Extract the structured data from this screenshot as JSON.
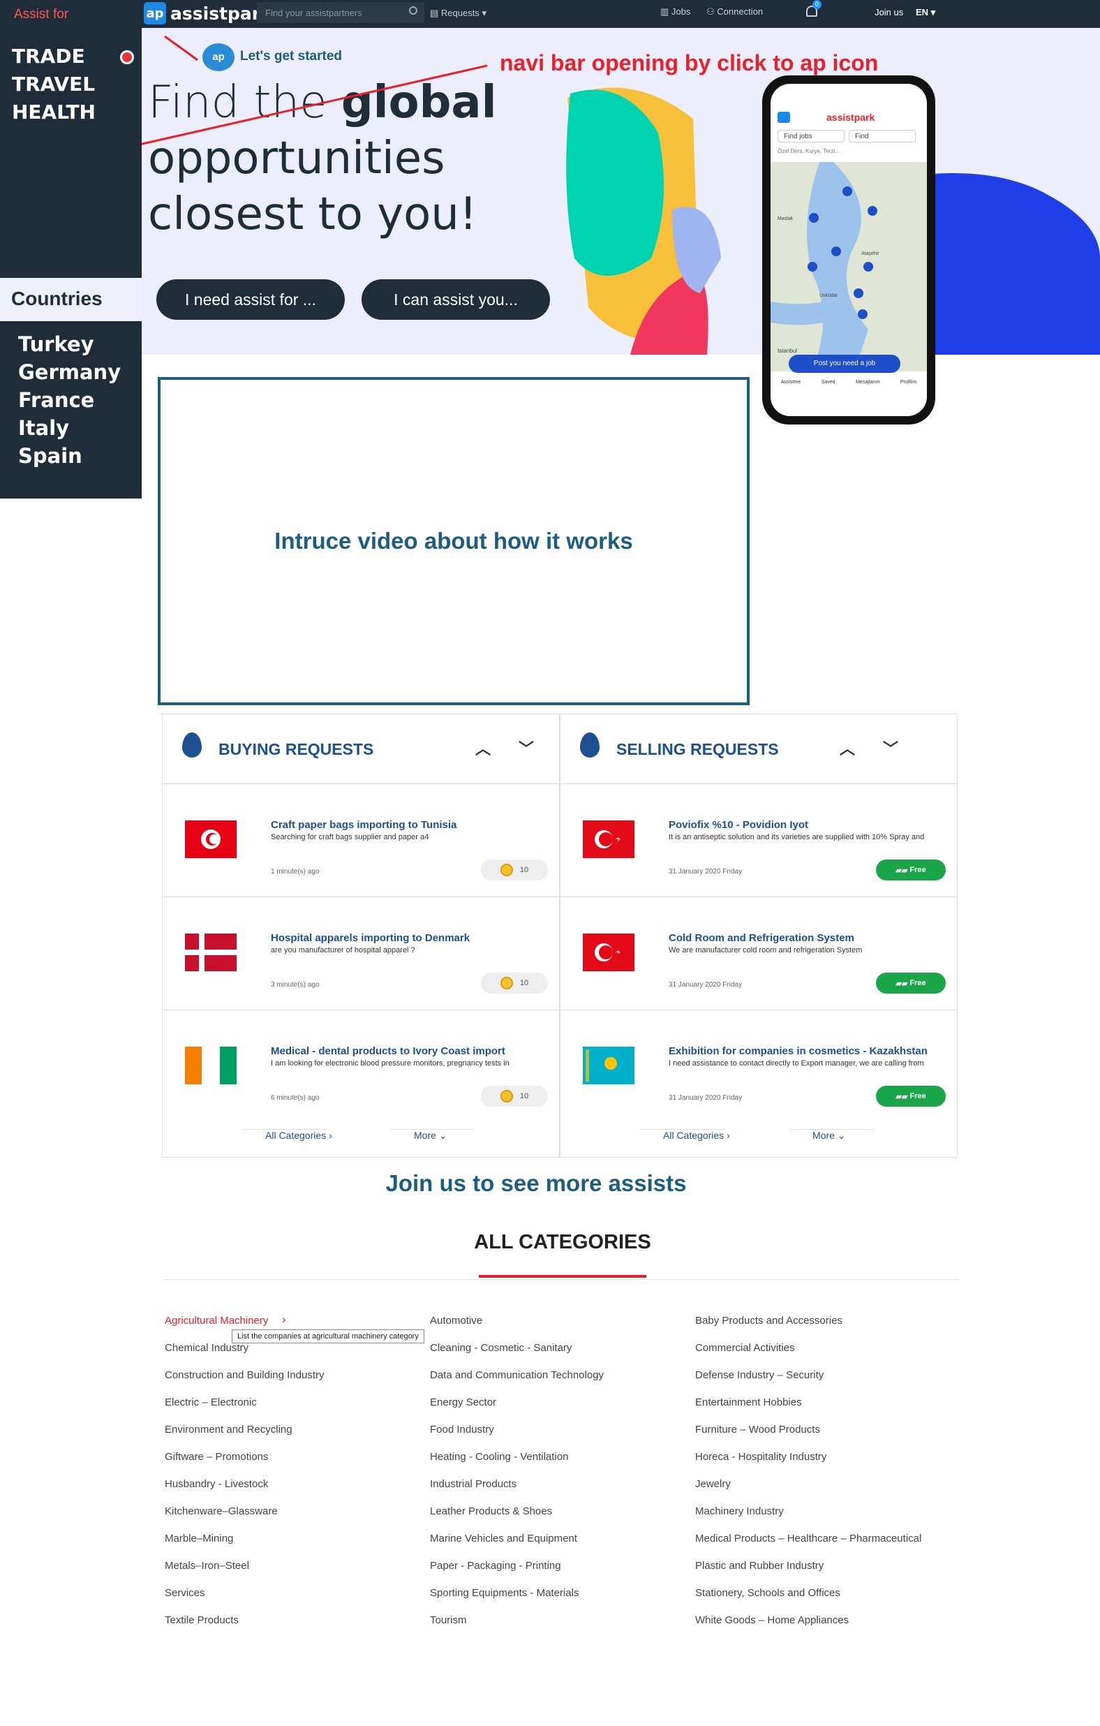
{
  "topbar": {
    "logo_text": "assistpark",
    "logo_mark": "ap",
    "search_placeholder": "Find your assistpartners",
    "requests_label": "Requests",
    "jobs_label": "Jobs",
    "connection_label": "Connection",
    "notif_count": "0",
    "join_label": "Join us",
    "lang_label": "EN"
  },
  "sidebar": {
    "assist_for": "Assist for",
    "categories": [
      "TRADE",
      "TRAVEL",
      "HEALTH"
    ],
    "countries_title": "Countries",
    "countries": [
      "Turkey",
      "Germany",
      "France",
      "Italy",
      "Spain"
    ]
  },
  "hero": {
    "started": "Let's get started",
    "ap_mark": "ap",
    "line1a": "Find the ",
    "line1b": "global",
    "line2": "opportunities",
    "line3": "closest to you!",
    "btn_need": "I need assist for ...",
    "btn_can": "I can assist you...",
    "annotation": "navi bar opening by click to ap icon"
  },
  "phone": {
    "brand": "assistpark",
    "tab_find_jobs": "Find jobs",
    "tab_find": "Find",
    "search_placeholder": "Özel Ders, Kurye, Terzi...",
    "cta": "Post you need a job",
    "nav": [
      "Assistme",
      "Saved",
      "Mesajlarım",
      "Profilim"
    ],
    "map_labels": [
      "Maslak",
      "Ataşehir",
      "Üsküdar",
      "Istanbul"
    ]
  },
  "video": {
    "text": "Intruce video about how it works"
  },
  "buying": {
    "title": "BUYING REQUESTS",
    "items": [
      {
        "title": "Craft paper bags importing to Tunisia",
        "desc": "Searching for craft bags supplier and paper a4",
        "time": "1 minute(s) ago",
        "coins": "10"
      },
      {
        "title": "Hospital apparels importing to Denmark",
        "desc": "are you manufacturer of hospital apparel ?",
        "time": "3 minute(s) ago",
        "coins": "10"
      },
      {
        "title": "Medical - dental products to Ivory Coast import",
        "desc": "I am looking for electronic blood pressure monitors, pregnancy tests in",
        "time": "6 minute(s) ago",
        "coins": "10"
      }
    ],
    "all_categories": "All Categories",
    "more": "More"
  },
  "selling": {
    "title": "SELLING REQUESTS",
    "items": [
      {
        "title": "Poviofix %10 - Povidion Iyot",
        "desc": "It is an antiseptic solution and its varieties are supplied with 10% Spray and",
        "time": "31 January 2020 Friday",
        "badge": "Free"
      },
      {
        "title": "Cold Room and Refrigeration System",
        "desc": "We are manufacturer cold room and refrigeration System",
        "time": "31 January 2020 Friday",
        "badge": "Free"
      },
      {
        "title": "Exhibition for companies in cosmetics - Kazakhstan",
        "desc": "I need assistance to contact directly to Export manager, we are calling from",
        "time": "31 January 2020 Friday",
        "badge": "Free"
      }
    ],
    "all_categories": "All Categories",
    "more": "More"
  },
  "join_us": "Join us to see more assists",
  "all_categories": {
    "title": "ALL CATEGORIES",
    "tooltip": "List the companies at agricultural machinery category",
    "col1": [
      "Agricultural Machinery",
      "Chemical Industry",
      "Construction and Building Industry",
      "Electric – Electronic",
      "Environment and Recycling",
      "Giftware – Promotions",
      "Husbandry - Livestock",
      "Kitchenware–Glassware",
      "Marble–Mining",
      "Metals–Iron–Steel",
      "Services",
      "Textile Products"
    ],
    "col2": [
      "Automotive",
      "Cleaning - Cosmetic - Sanitary",
      "Data and Communication Technology",
      "Energy Sector",
      "Food Industry",
      "Heating - Cooling - Ventilation",
      "Industrial Products",
      "Leather Products & Shoes",
      "Marine Vehicles and Equipment",
      "Paper - Packaging - Printing",
      "Sporting Equipments - Materials",
      "Tourism"
    ],
    "col3": [
      "Baby Products and Accessories",
      "Commercial Activities",
      "Defense Industry – Security",
      "Entertainment Hobbies",
      "Furniture – Wood Products",
      "Horeca - Hospitality Industry",
      "Jewelry",
      "Machinery Industry",
      "Medical Products – Healthcare – Pharmaceutical",
      "Plastic and Rubber Industry",
      "Stationery, Schools and Offices",
      "White Goods – Home Appliances"
    ]
  },
  "colors": {
    "navy": "#1f2d3a",
    "accent_blue": "#1d4f91",
    "accent_red": "#e8202a",
    "free_green": "#1aa548"
  }
}
